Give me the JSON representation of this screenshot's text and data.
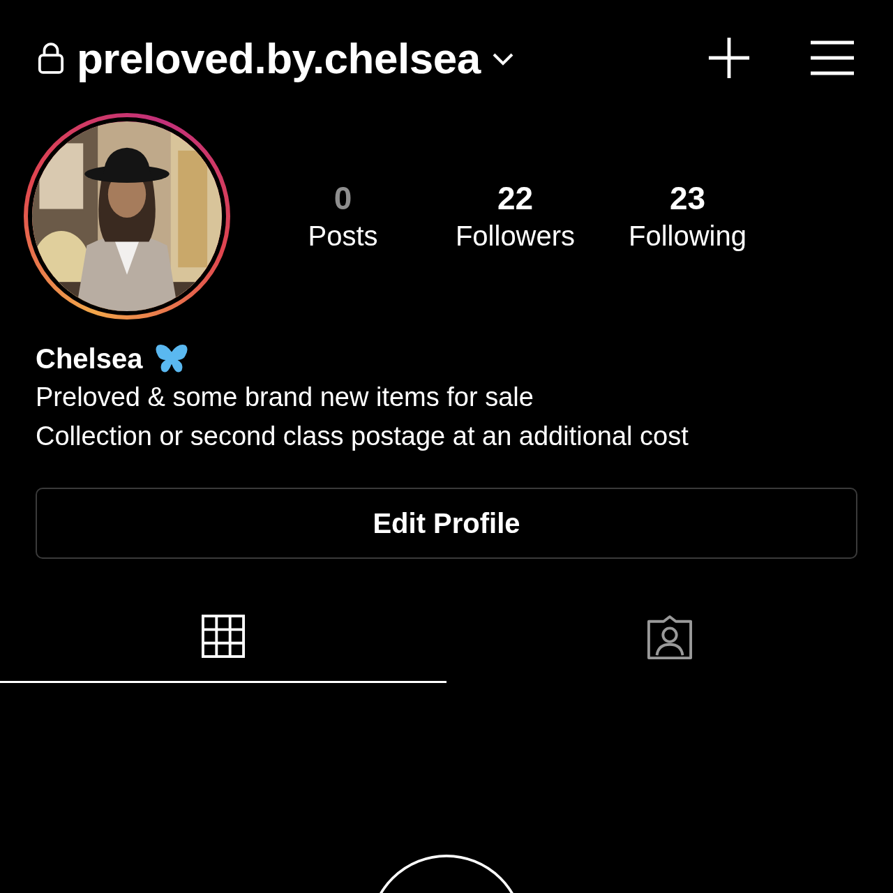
{
  "header": {
    "username": "preloved.by.chelsea"
  },
  "profile": {
    "kind": "picture",
    "has_story": true
  },
  "stats": [
    {
      "count": "0",
      "label": "Posts",
      "dimmed": true
    },
    {
      "count": "22",
      "label": "Followers",
      "dimmed": false
    },
    {
      "count": "23",
      "label": "Following",
      "dimmed": false
    }
  ],
  "bio": {
    "name": "Chelsea",
    "lines": [
      "Preloved & some brand new items for sale",
      "Collection or second class postage at an additional cost"
    ]
  },
  "edit_button": "Edit Profile",
  "tabs": [
    {
      "kind": "grid",
      "selected": true
    },
    {
      "kind": "tagged",
      "selected": false
    }
  ]
}
